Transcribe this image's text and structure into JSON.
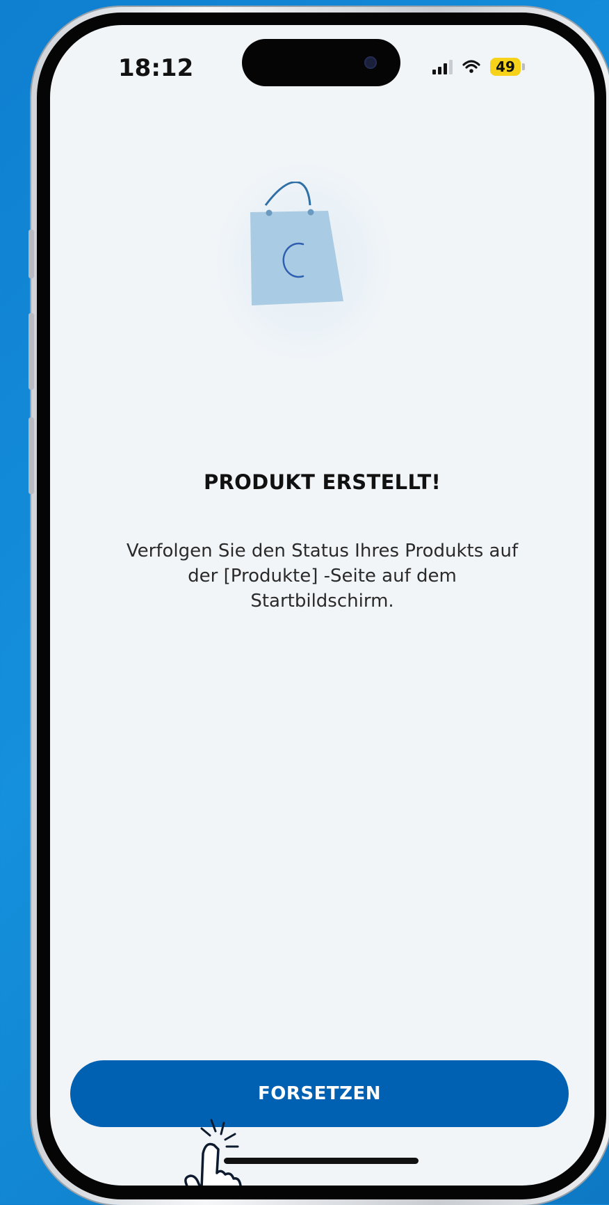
{
  "status_bar": {
    "time": "18:12",
    "battery": "49",
    "icons": [
      "signal-icon",
      "wifi-icon",
      "battery-icon"
    ]
  },
  "hero": {
    "icon": "shopping-bag-loading-icon"
  },
  "content": {
    "title": "PRODUKT ERSTELLT!",
    "description": "Verfolgen Sie den Status Ihres Produkts auf\nder  [Produkte] -Seite auf dem\nStartbildschirm."
  },
  "action": {
    "continue_label": "FORSETZEN"
  },
  "overlay": {
    "icon": "tap-hand-icon"
  },
  "colors": {
    "background": "#1590dc",
    "screen": "#f1f5f8",
    "primary_button": "#0061b2",
    "battery": "#f6d21a",
    "bag": "#a9cbe3"
  }
}
